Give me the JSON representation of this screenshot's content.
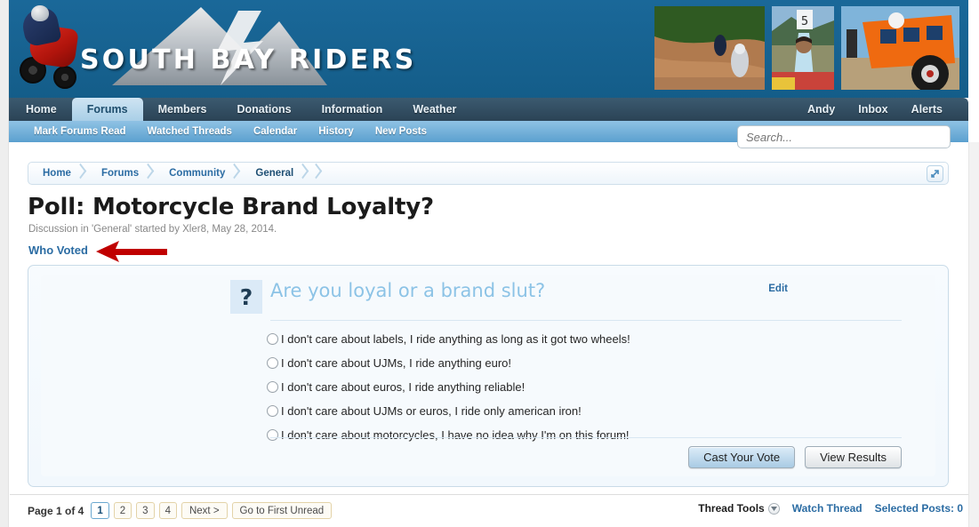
{
  "site": {
    "logo_text": "SOUTH BAY RIDERS",
    "header_photos": [
      "dirt-bike-trail-photo",
      "rider-with-number-board-photo",
      "orange-rally-truck-photo"
    ]
  },
  "nav": {
    "items": [
      {
        "label": "Home",
        "active": false
      },
      {
        "label": "Forums",
        "active": true
      },
      {
        "label": "Members",
        "active": false
      },
      {
        "label": "Donations",
        "active": false
      },
      {
        "label": "Information",
        "active": false
      },
      {
        "label": "Weather",
        "active": false
      }
    ],
    "right_items": [
      {
        "label": "Andy"
      },
      {
        "label": "Inbox"
      },
      {
        "label": "Alerts"
      }
    ]
  },
  "subnav": {
    "items": [
      {
        "label": "Mark Forums Read"
      },
      {
        "label": "Watched Threads"
      },
      {
        "label": "Calendar"
      },
      {
        "label": "History"
      },
      {
        "label": "New Posts"
      }
    ]
  },
  "search": {
    "value": "",
    "placeholder": "Search..."
  },
  "breadcrumb": {
    "items": [
      {
        "label": "Home"
      },
      {
        "label": "Forums"
      },
      {
        "label": "Community"
      },
      {
        "label": "General"
      }
    ],
    "expand_icon": "expand-arrow-icon"
  },
  "thread": {
    "title": "Poll: Motorcycle Brand Loyalty?",
    "meta": "Discussion in 'General' started by Xler8, May 28, 2014.",
    "who_voted_label": "Who Voted"
  },
  "poll": {
    "icon_glyph": "?",
    "question": "Are you loyal or a brand slut?",
    "edit_label": "Edit",
    "options": [
      {
        "label": "I don't care about labels, I ride anything as long as it got two wheels!",
        "selected": false
      },
      {
        "label": "I don't care about UJMs, I ride anything euro!",
        "selected": false
      },
      {
        "label": "I don't care about euros, I ride anything reliable!",
        "selected": false
      },
      {
        "label": "I don't care about UJMs or euros, I ride only american iron!",
        "selected": false
      },
      {
        "label": "I don't care about motorcycles, I have no idea why I'm on this forum!",
        "selected": false
      }
    ],
    "cast_vote_label": "Cast Your Vote",
    "view_results_label": "View Results"
  },
  "pagination": {
    "label": "Page 1 of 4",
    "pages": [
      "1",
      "2",
      "3",
      "4"
    ],
    "current_page": "1",
    "next_label": "Next >",
    "first_unread_label": "Go to First Unread"
  },
  "footer_tools": {
    "thread_tools_label": "Thread Tools",
    "watch_thread_label": "Watch Thread",
    "selected_posts_label": "Selected Posts: 0"
  },
  "annotation": {
    "arrow_color": "#c00000",
    "points_to": "who-voted-link"
  },
  "colors": {
    "header_blue": "#15628f",
    "nav_dark": "#2b4356",
    "subnav_blue": "#5ba0cf",
    "link_blue": "#2b6ca3",
    "question_blue": "#8cc3e6"
  }
}
